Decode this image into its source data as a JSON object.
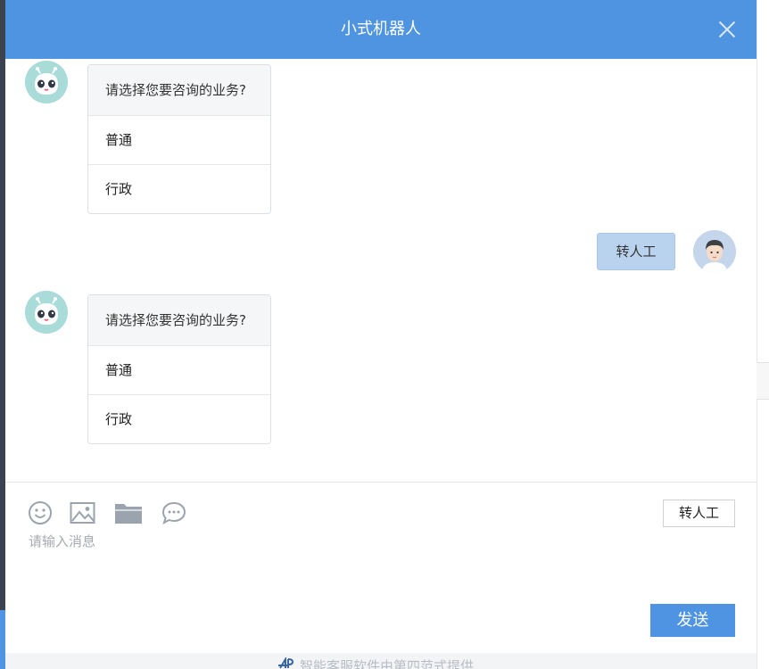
{
  "header": {
    "title": "小式机器人"
  },
  "messages": [
    {
      "from": "bot",
      "question": "请选择您要咨询的业务?",
      "options": [
        "普通",
        "行政"
      ]
    },
    {
      "from": "user",
      "text": "转人工"
    },
    {
      "from": "bot",
      "question": "请选择您要咨询的业务?",
      "options": [
        "普通",
        "行政"
      ]
    }
  ],
  "toolbar": {
    "icons": [
      "emoji-icon",
      "image-icon",
      "folder-icon",
      "chat-bubble-icon"
    ],
    "transfer_label": "转人工"
  },
  "input": {
    "placeholder": "请输入消息",
    "value": ""
  },
  "send_label": "发送",
  "footer": {
    "text": "智能客服软件由第四范式提供"
  },
  "colors": {
    "header": "#4e94e0",
    "send": "#4f94e3",
    "user_bubble": "#b9d3ef",
    "bot_avatar": "#a9dcd9"
  }
}
